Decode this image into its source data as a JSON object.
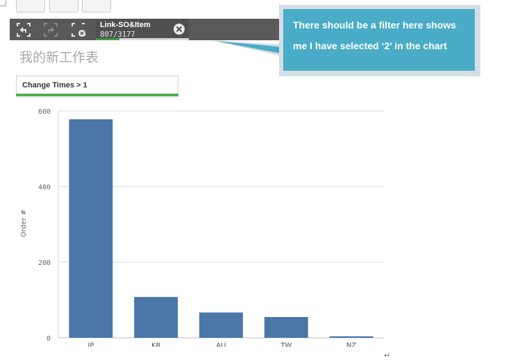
{
  "toolbar": {
    "selection_chip": {
      "title": "Link-SO&Item",
      "count": "807/3177",
      "fill_fraction": 0.25
    }
  },
  "sheet": {
    "title": "我的新工作表"
  },
  "filter": {
    "label": "Change Times > 1"
  },
  "callout": {
    "line1": "There should be a filter here shows",
    "line2": "me I have selected ‘2’ in the chart"
  },
  "colors": {
    "bar": "#4a76a8",
    "callout": "#4aacc6",
    "toolbar": "#595959",
    "selection_green": "#4caf50"
  },
  "chart_data": {
    "type": "bar",
    "categories": [
      "JP",
      "KR",
      "AU",
      "TW",
      "NZ"
    ],
    "values": [
      578,
      108,
      67,
      55,
      4
    ],
    "ylabel": "Order #",
    "xlabel": "",
    "ylim": [
      0,
      600
    ],
    "yticks": [
      0,
      200,
      400,
      600
    ],
    "grid": true
  }
}
